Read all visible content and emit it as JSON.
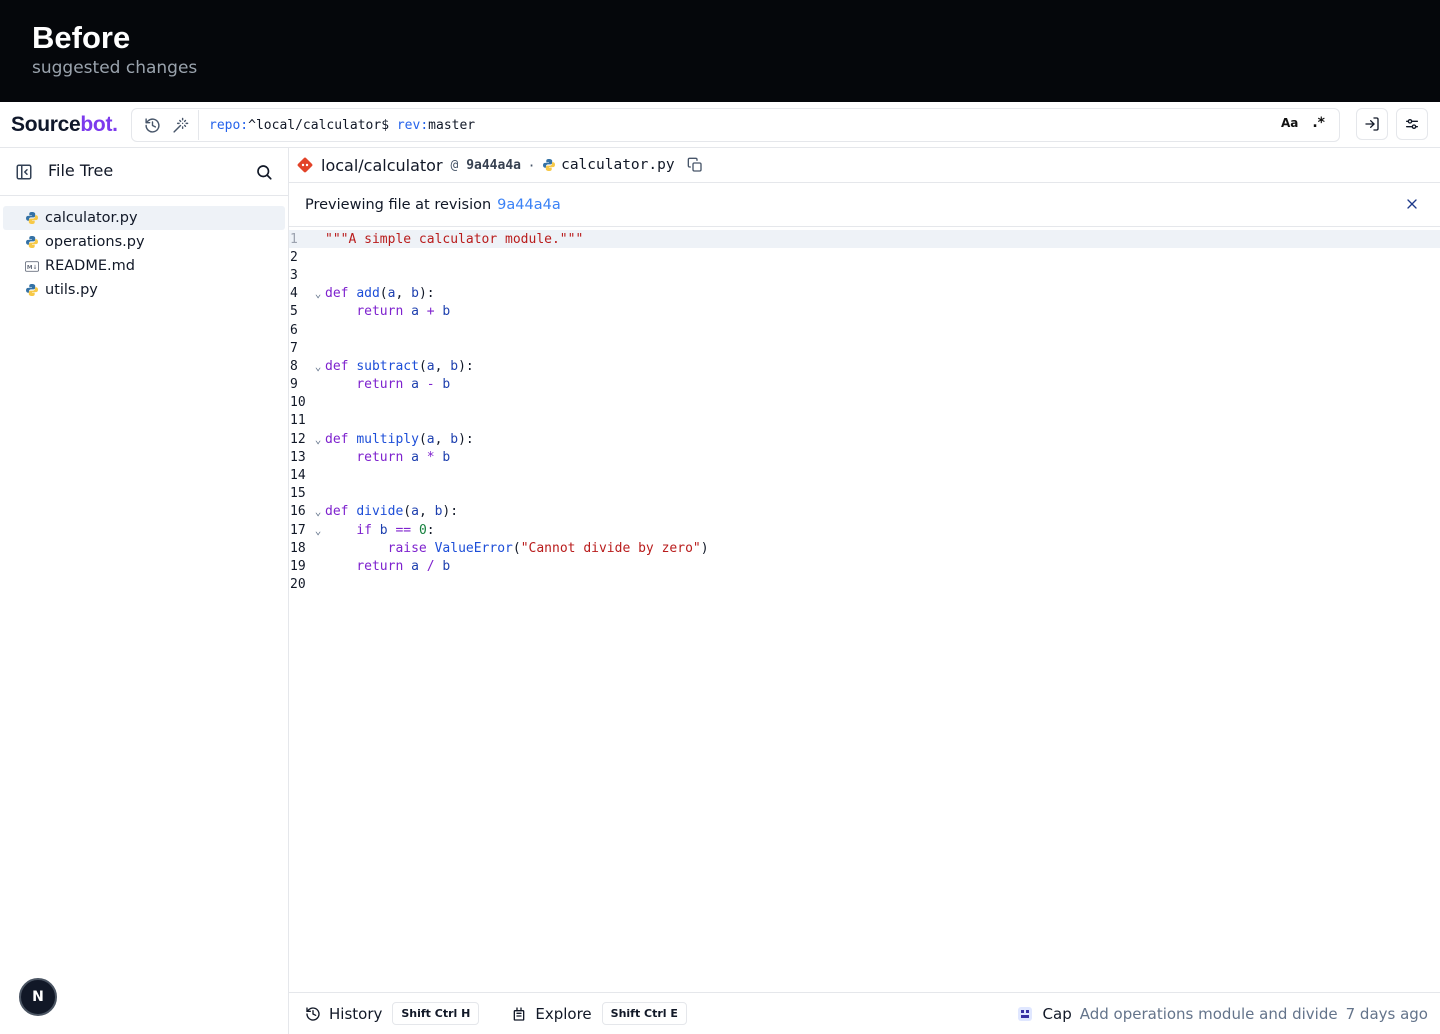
{
  "banner": {
    "title": "Before",
    "subtitle": "suggested changes"
  },
  "logo": {
    "part1": "Source",
    "part2": "bot."
  },
  "search": {
    "query_repo_key": "repo:",
    "query_repo_value": "^local/calculator$",
    "query_rev_key": "rev:",
    "query_rev_value": "master",
    "case_toggle": "Aa",
    "regex_toggle": ".*"
  },
  "sidebar": {
    "title": "File Tree",
    "files": [
      {
        "name": "calculator.py",
        "icon": "python-icon",
        "active": true
      },
      {
        "name": "operations.py",
        "icon": "python-icon",
        "active": false
      },
      {
        "name": "README.md",
        "icon": "markdown-icon",
        "active": false
      },
      {
        "name": "utils.py",
        "icon": "python-icon",
        "active": false
      }
    ],
    "avatar_initial": "N"
  },
  "breadcrumb": {
    "repo": "local/calculator",
    "rev_prefix": "@ ",
    "rev": "9a44a4a",
    "separator": "·",
    "file": "calculator.py"
  },
  "preview": {
    "text": "Previewing file at revision",
    "revision": "9a44a4a"
  },
  "code": {
    "lines": [
      "\"\"\"A simple calculator module.\"\"\"",
      "",
      "",
      "def add(a, b):",
      "    return a + b",
      "",
      "",
      "def subtract(a, b):",
      "    return a - b",
      "",
      "",
      "def multiply(a, b):",
      "    return a * b",
      "",
      "",
      "def divide(a, b):",
      "    if b == 0:",
      "        raise ValueError(\"Cannot divide by zero\")",
      "    return a / b",
      ""
    ]
  },
  "bottombar": {
    "history_label": "History",
    "history_shortcut": "Shift Ctrl H",
    "explore_label": "Explore",
    "explore_shortcut": "Shift Ctrl E",
    "commit_author": "Cap",
    "commit_message": "Add operations module and divide",
    "commit_time": "7 days ago"
  },
  "colors": {
    "accent": "#7c3aed",
    "link": "#3b82f6",
    "banner_bg": "#05070b"
  }
}
